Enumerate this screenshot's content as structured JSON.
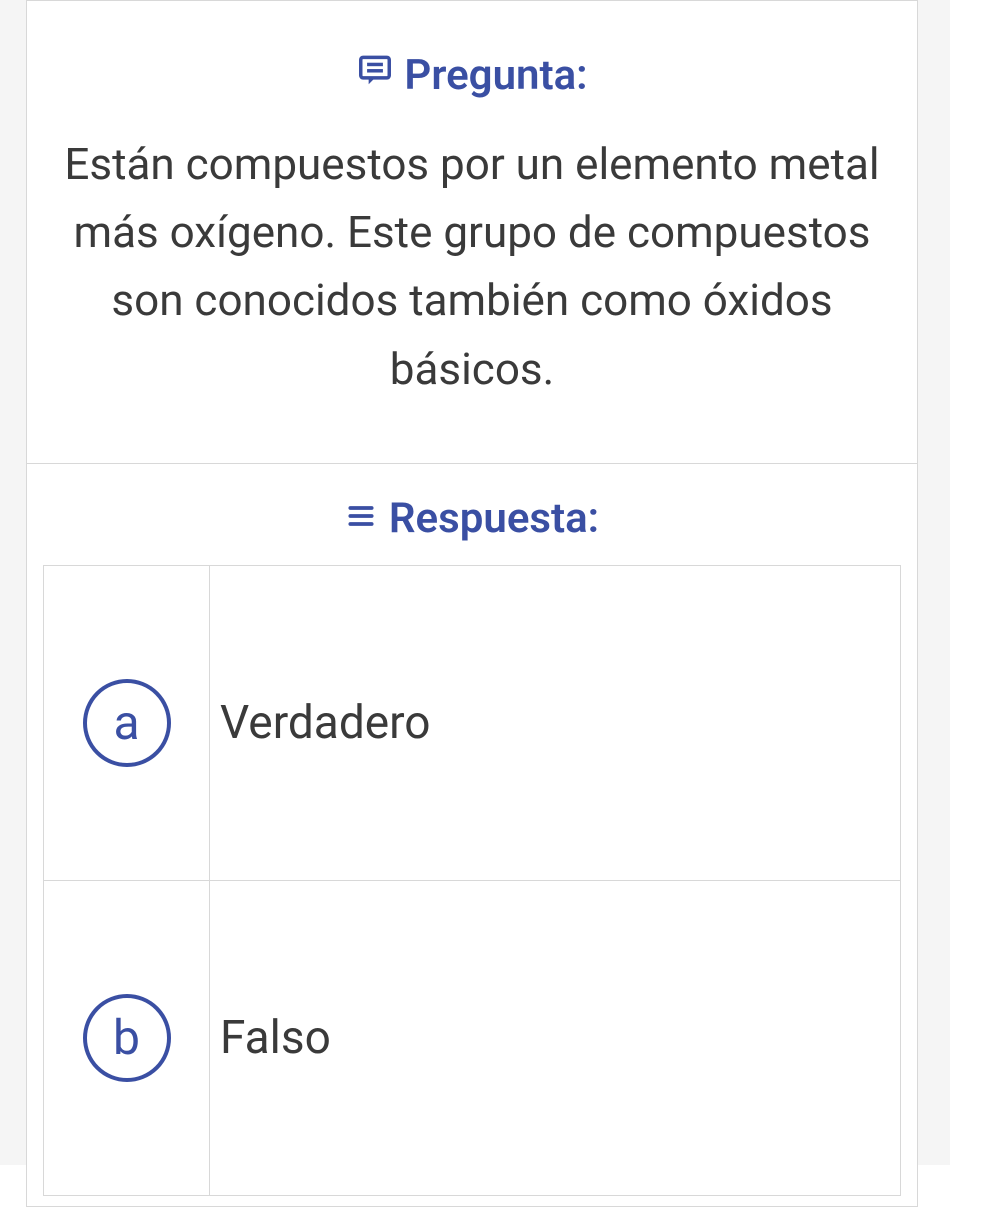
{
  "question": {
    "label": "Pregunta:",
    "text": "Están compuestos por un elemento metal más oxígeno. Este grupo de  compuestos son conocidos también como óxidos básicos."
  },
  "answer": {
    "label": "Respuesta:",
    "options": [
      {
        "letter": "a",
        "text": "Verdadero"
      },
      {
        "letter": "b",
        "text": "Falso"
      }
    ]
  }
}
